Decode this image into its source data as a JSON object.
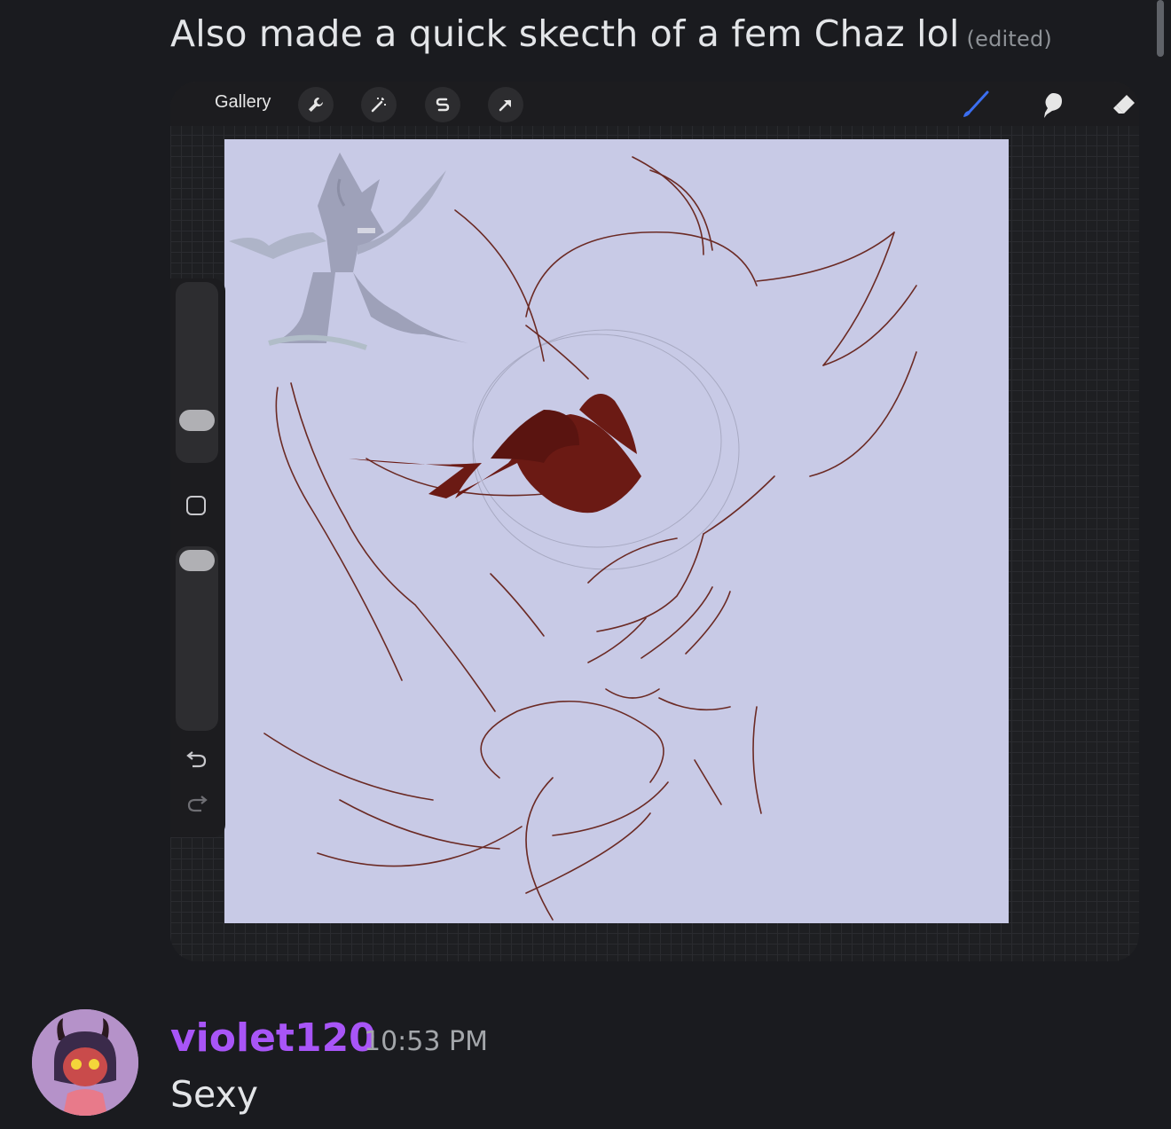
{
  "message": {
    "text": "Also made a quick skecth of a fem Chaz lol",
    "edited_label": "(edited)"
  },
  "attachment": {
    "app": {
      "gallery_label": "Gallery",
      "left_tools": [
        "wrench-icon",
        "magic-wand-icon",
        "selection-icon",
        "transform-arrow-icon"
      ],
      "right_tools": [
        "brush-icon",
        "smudge-icon",
        "eraser-icon"
      ],
      "active_tool": "brush-icon",
      "accent_color": "#3b6ef0",
      "canvas_color": "#c8cae6",
      "line_color": "#6b2a24"
    }
  },
  "reply": {
    "username": "violet120",
    "timestamp": "10:53 PM",
    "text": "Sexy",
    "username_color": "#a855f7"
  }
}
